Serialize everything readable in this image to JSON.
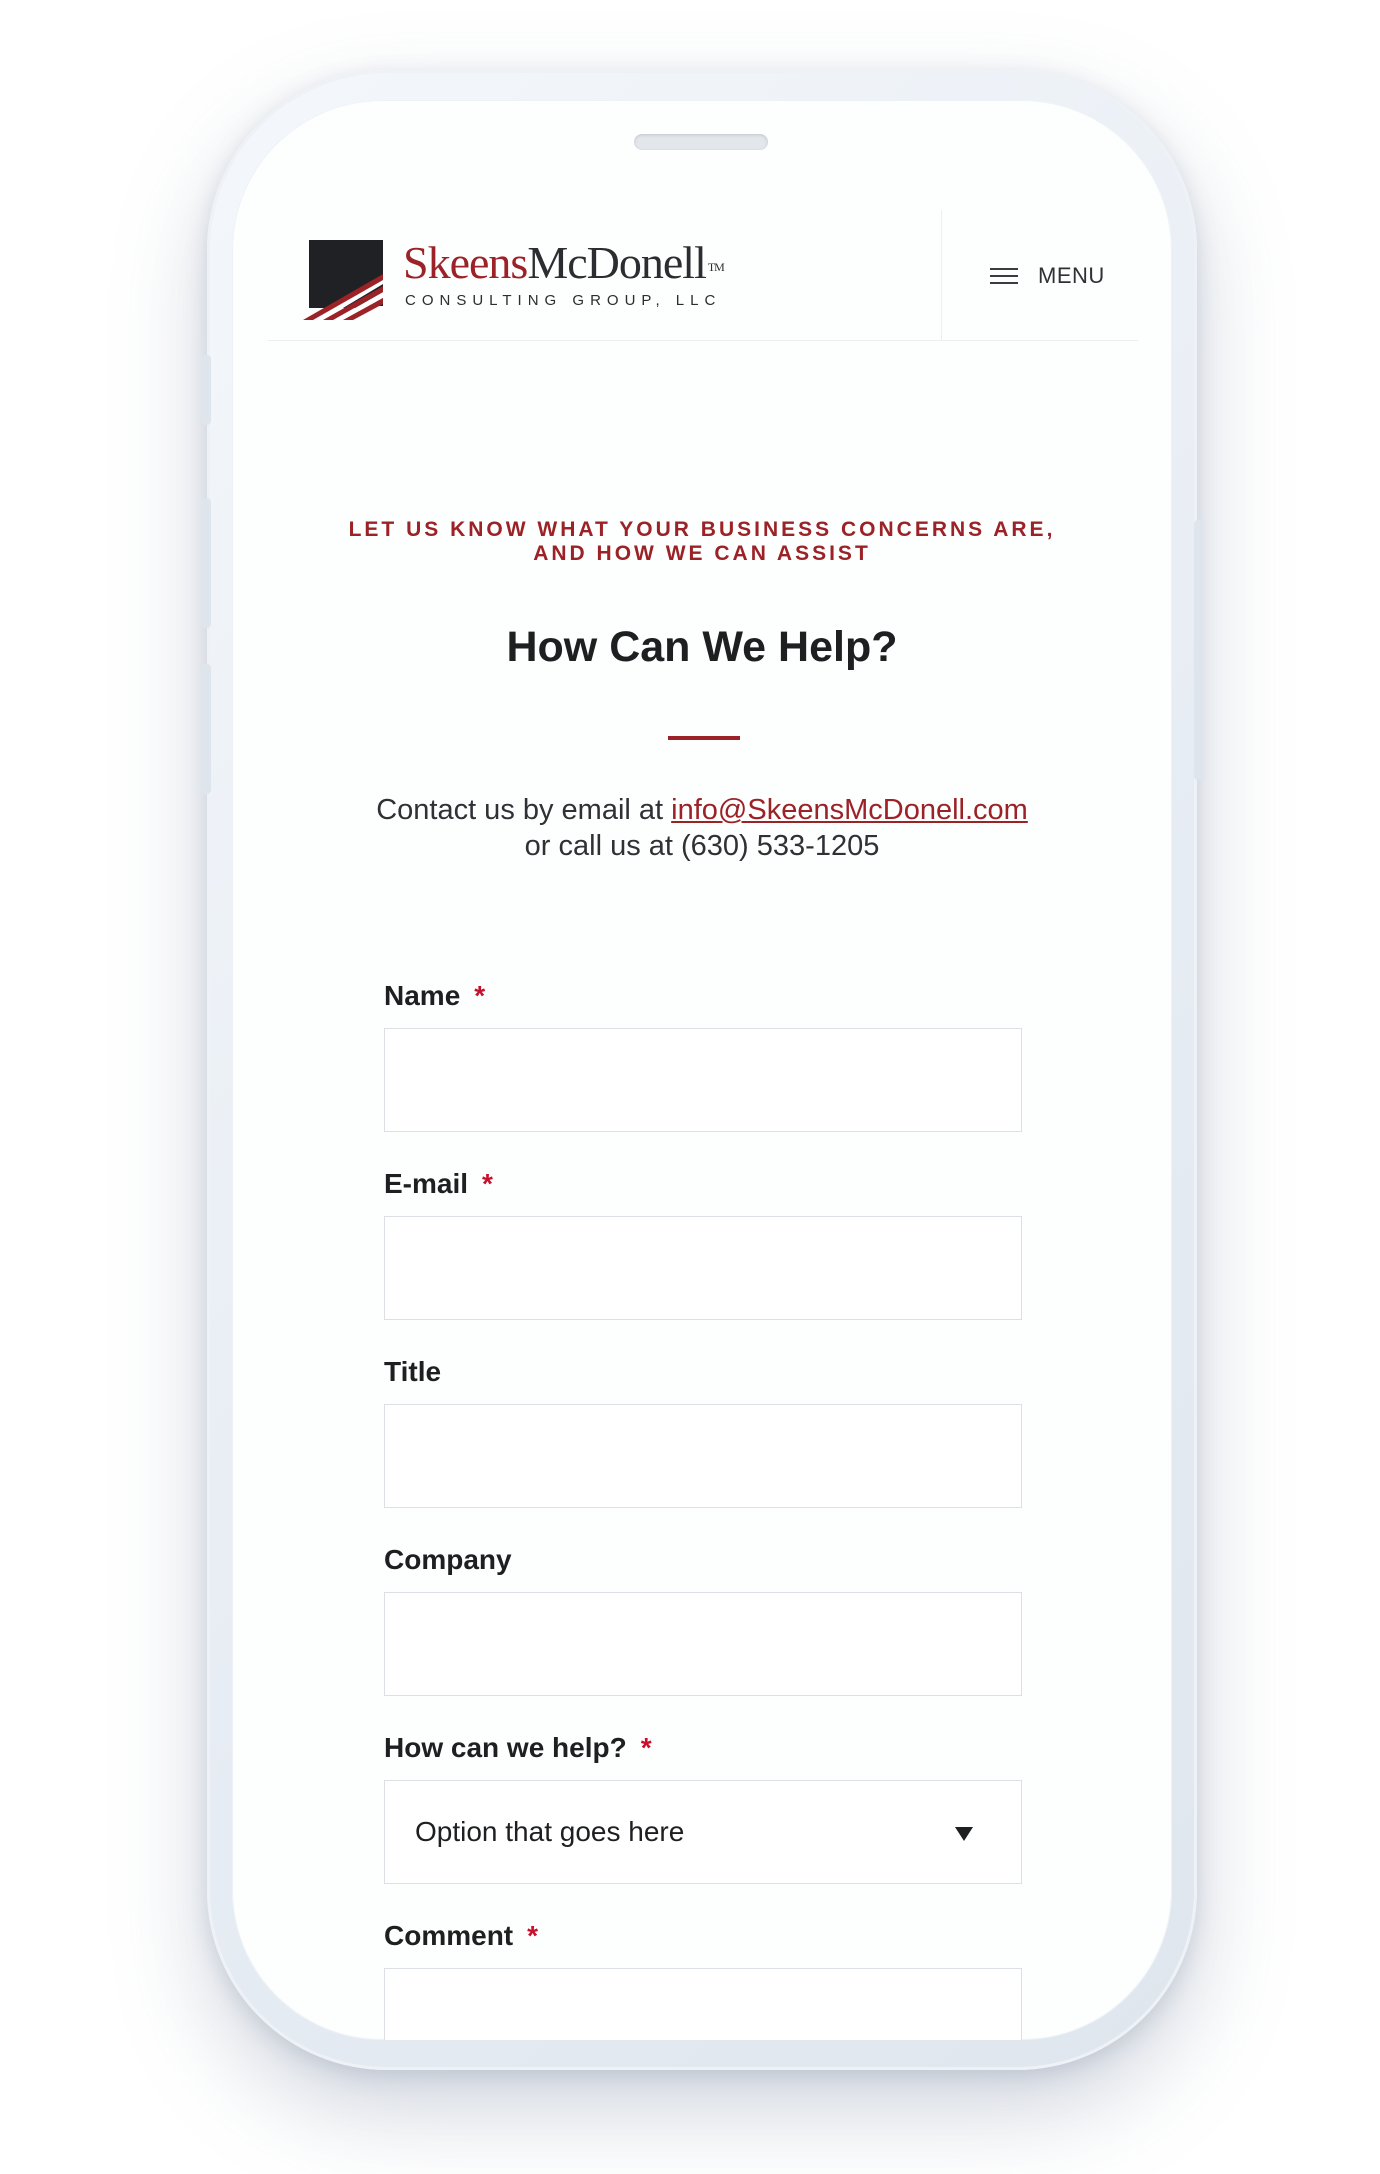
{
  "header": {
    "logo": {
      "name_part1": "Skeens",
      "name_part2": "McDonell",
      "trademark": "TM",
      "subtitle": "CONSULTING GROUP, LLC"
    },
    "menu_label": "MENU"
  },
  "hero": {
    "eyebrow_line1": "LET US KNOW WHAT YOUR BUSINESS CONCERNS ARE,",
    "eyebrow_line2": "AND HOW WE CAN ASSIST",
    "heading": "How Can We Help?",
    "contact_prefix": "Contact us by email at",
    "contact_email": "info@SkeensMcDonell.com",
    "contact_phone_line": "or call us at (630) 533-1205"
  },
  "form": {
    "required_marker": "*",
    "name_label": "Name",
    "email_label": "E-mail",
    "title_label": "Title",
    "company_label": "Company",
    "help_label": "How can we help?",
    "help_selected": "Option that goes here",
    "comment_label": "Comment"
  },
  "colors": {
    "accent": "#9b2226",
    "required": "#c8102e",
    "text": "#1e1f21"
  },
  "icons": {
    "menu": "hamburger-icon",
    "select": "caret-down-icon"
  }
}
